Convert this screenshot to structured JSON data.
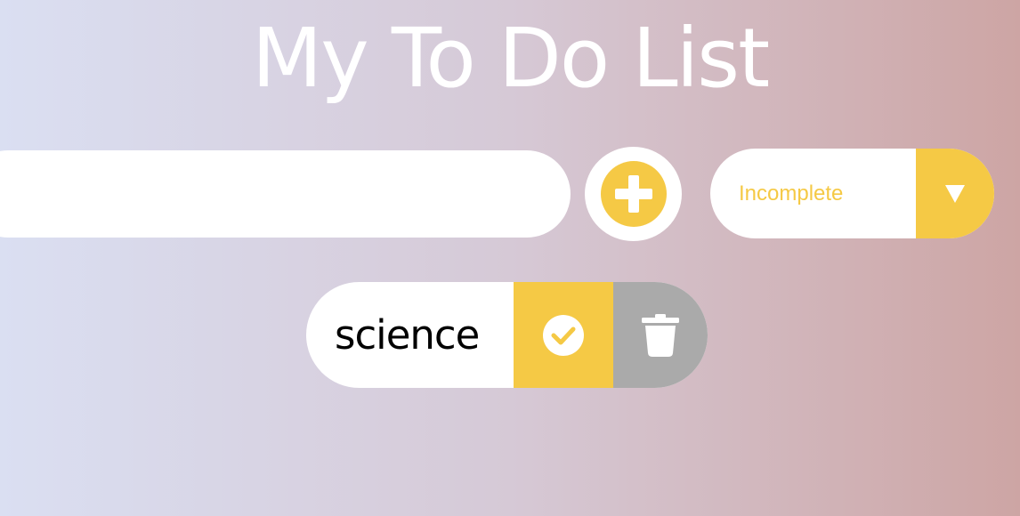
{
  "header": {
    "title": "My To Do List"
  },
  "form": {
    "input_value": "",
    "placeholder": "",
    "add_icon": "plus-circle-icon"
  },
  "filter": {
    "selected": "Incomplete",
    "arrow_icon": "triangle-down-icon"
  },
  "todos": [
    {
      "text": "science",
      "complete_icon": "check-circle-icon",
      "delete_icon": "trash-icon"
    }
  ],
  "colors": {
    "accent": "#f5c945",
    "trash": "#aaaaaa",
    "background_left": "#dadff2",
    "background_right": "#cda5a4"
  }
}
